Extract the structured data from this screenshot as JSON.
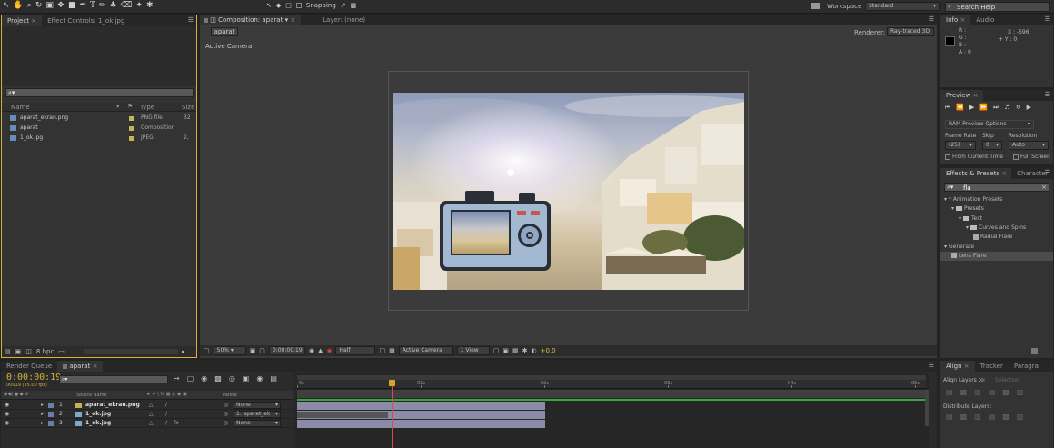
{
  "toolbar": {
    "snapping": "Snapping",
    "workspace_label": "Workspace",
    "workspace_value": "Standard",
    "search_placeholder": "Search Help"
  },
  "project": {
    "tab_project": "Project",
    "tab_effect_controls": "Effect Controls: 1_ok.jpg",
    "search_placeholder": "⌕▾",
    "columns": {
      "name": "Name",
      "type": "Type",
      "size": "Size"
    },
    "items": [
      {
        "name": "aparat_ekran.png",
        "type": "PNG file",
        "size": "32",
        "color": "#c8b45a"
      },
      {
        "name": "aparat",
        "type": "Composition",
        "size": "",
        "color": "#c8b45a"
      },
      {
        "name": "1_ok.jpg",
        "type": "JPEG",
        "size": "2,",
        "color": "#c8b45a"
      }
    ],
    "bpc": "8 bpc"
  },
  "comp": {
    "tab_composition": "Composition: aparat",
    "tab_layer": "Layer: (none)",
    "comp_button": "aparat",
    "renderer_label": "Renderer:",
    "renderer_value": "Ray-traced 3D",
    "active_camera": "Active Camera",
    "footer": {
      "zoom": "50%",
      "timecode": "0:00:00:19",
      "resolution": "Half",
      "camera": "Active Camera",
      "views": "1 View",
      "exposure": "+0,0"
    }
  },
  "info": {
    "tab_info": "Info",
    "tab_audio": "Audio",
    "r": "R :",
    "g": "G :",
    "b": "B :",
    "a": "A : 0",
    "x": "X : -596",
    "y": "+ Y : 0"
  },
  "preview": {
    "tab": "Preview",
    "ram_options": "RAM Preview Options",
    "frame_rate_label": "Frame Rate",
    "skip_label": "Skip",
    "resolution_label": "Resolution",
    "frame_rate": "(25)",
    "skip": "0",
    "resolution": "Auto",
    "from_current": "From Current Time",
    "full_screen": "Full Screen"
  },
  "effects": {
    "tab": "Effects & Presets",
    "tab_character": "Character",
    "search": "fla",
    "tree": [
      {
        "label": "* Animation Presets",
        "indent": 0
      },
      {
        "label": "Presets",
        "indent": 1
      },
      {
        "label": "Text",
        "indent": 2
      },
      {
        "label": "Curves and Spins",
        "indent": 3
      },
      {
        "label": "Radial Flare",
        "indent": 4
      },
      {
        "label": "Generate",
        "indent": 0
      },
      {
        "label": "Lens Flare",
        "indent": 1
      }
    ]
  },
  "timeline": {
    "tab_render": "Render Queue",
    "tab_comp": "aparat",
    "timecode": "0:00:00:19",
    "frame_info": "00019 (25.00 fps)",
    "search": "⌕▾",
    "col_source": "Source Name",
    "col_parent": "Parent",
    "layers": [
      {
        "num": "1",
        "name": "aparat_ekran.png",
        "parent": "None"
      },
      {
        "num": "2",
        "name": "1_ok.jpg",
        "parent": "1. aparat_ek"
      },
      {
        "num": "3",
        "name": "1_ok.jpg",
        "parent": "None"
      }
    ],
    "ruler": [
      "0s",
      "01s",
      "02s",
      "03s",
      "04s",
      "05s"
    ]
  },
  "align": {
    "tab_align": "Align",
    "tab_tracker": "Tracker",
    "tab_paragraph": "Paragra",
    "align_to": "Align Layers to:",
    "align_to_value": "Selection",
    "distribute": "Distribute Layers:"
  }
}
